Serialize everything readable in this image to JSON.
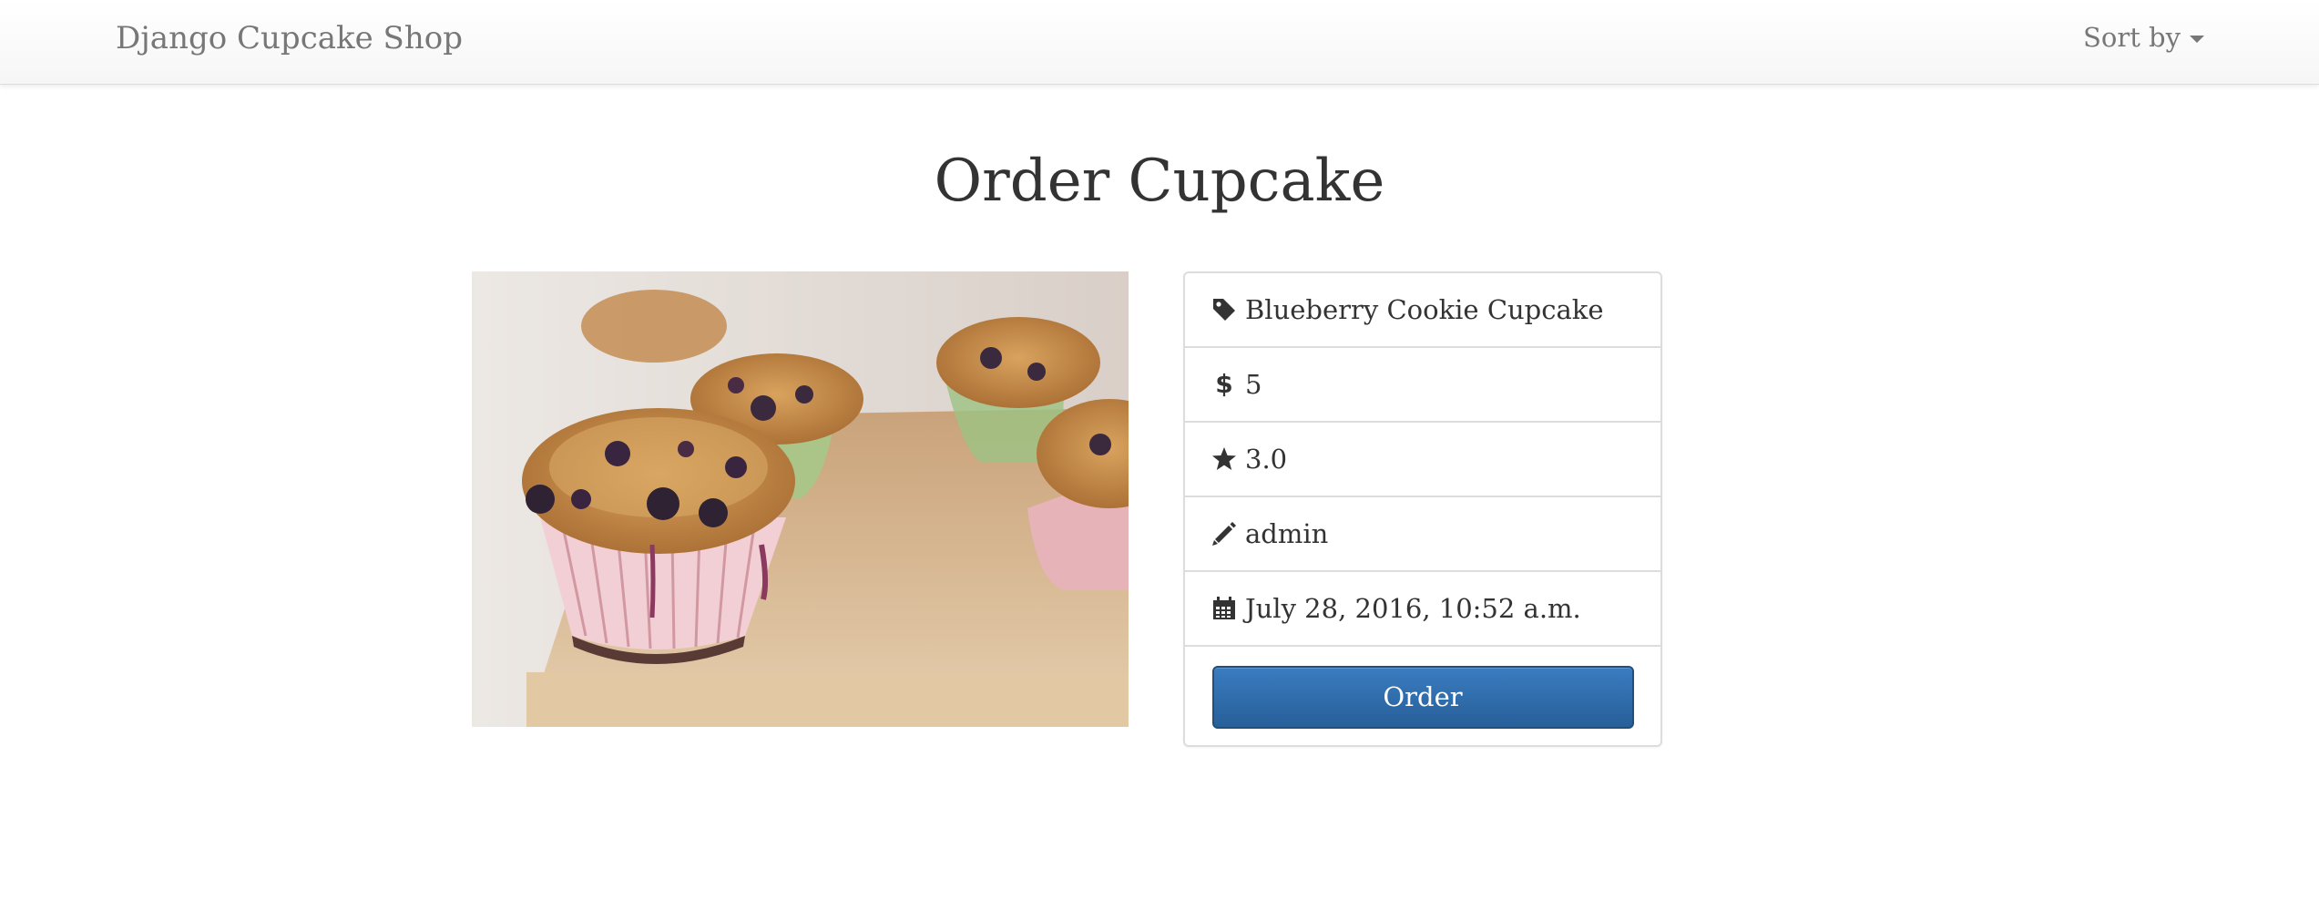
{
  "navbar": {
    "brand": "Django Cupcake Shop",
    "sort_label": "Sort by"
  },
  "page": {
    "title": "Order Cupcake"
  },
  "details": {
    "name": "Blueberry Cookie Cupcake",
    "price": "5",
    "rating": "3.0",
    "author": "admin",
    "date": "July 28, 2016, 10:52 a.m.",
    "order_label": "Order"
  },
  "icons": {
    "name": "tag-icon",
    "price": "dollar-icon",
    "rating": "star-icon",
    "author": "pencil-icon",
    "date": "calendar-icon",
    "sort": "caret-down-icon"
  },
  "colors": {
    "navbar_text": "#777777",
    "button_primary": "#2d6ca8",
    "border": "#dddddd"
  }
}
